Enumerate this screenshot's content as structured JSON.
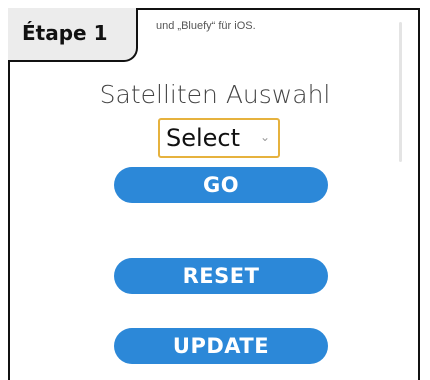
{
  "badge": {
    "label": "Étape 1"
  },
  "intro": {
    "text": "und „Bluefy“ für iOS."
  },
  "heading": {
    "text": "Satelliten Auswahl"
  },
  "select": {
    "value": "Select",
    "chevron": "⌄"
  },
  "buttons": {
    "go": "GO",
    "reset": "RESET",
    "update": "UPDATE"
  },
  "colors": {
    "button": "#2c88d8",
    "select_border": "#e6b23e",
    "badge_bg": "#ececec"
  }
}
